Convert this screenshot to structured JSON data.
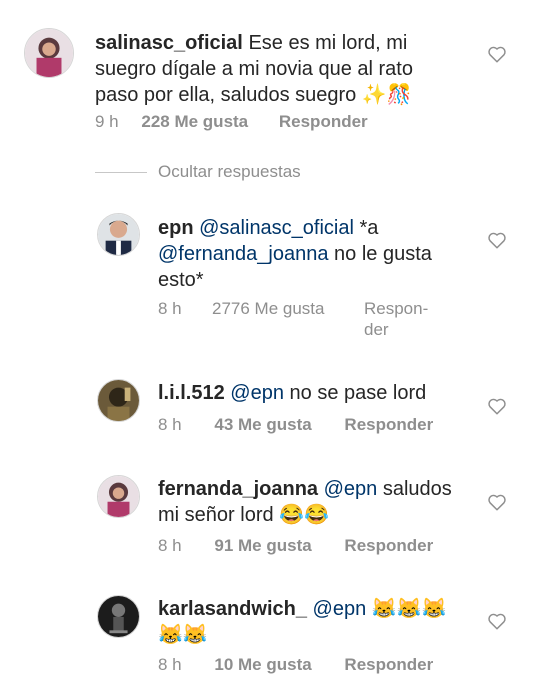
{
  "comments": [
    {
      "user": "salinasc_oficial",
      "pre": "",
      "mention": "",
      "text": "Ese es mi lord, mi suegro dígale a mi novia que al rato paso por ella, saludos suegro ✨🎊",
      "time": "9 h",
      "likes": "228 Me gusta",
      "reply": "Responder"
    },
    {
      "user": "epn",
      "mention": "@salinasc_oficial",
      "text1": "*a",
      "mention2": "@fernanda_joanna",
      "text2": "no le gusta esto*",
      "time": "8 h",
      "likes": "2776 Me gusta",
      "reply1": "Respon-",
      "reply2": "der"
    },
    {
      "user": "l.i.l.512",
      "mention": "@epn",
      "text": "no se pase lord",
      "time": "8 h",
      "likes": "43 Me gusta",
      "reply": "Responder"
    },
    {
      "user": "fernanda_joanna",
      "mention": "@epn",
      "text": "saludos mi señor lord 😂😂",
      "time": "8 h",
      "likes": "91 Me gusta",
      "reply": "Responder"
    },
    {
      "user": "karlasandwich_",
      "mention": "@epn",
      "text": "😹😹😹😹😹",
      "time": "8 h",
      "likes": "10 Me gusta",
      "reply": "Responder"
    }
  ],
  "hide_replies": "Ocultar respuestas",
  "icons": {
    "like": "heart-outline-icon"
  },
  "colors": {
    "text": "#262626",
    "meta": "#8e8e8e",
    "mention": "#003569",
    "divider": "#c7c7c7"
  }
}
